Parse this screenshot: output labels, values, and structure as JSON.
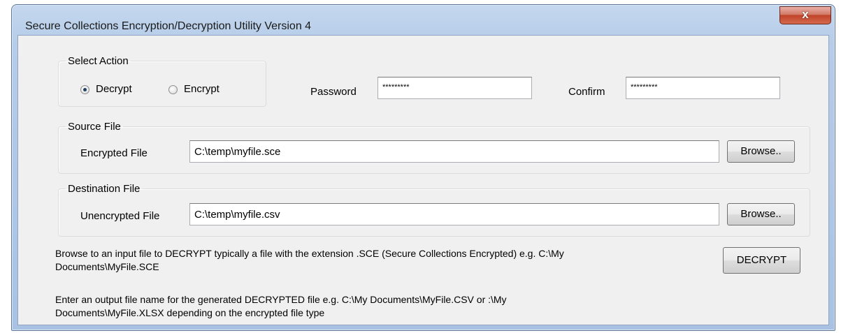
{
  "window": {
    "title": "Secure Collections Encryption/Decryption Utility Version 4",
    "close_symbol": "x"
  },
  "action": {
    "legend": "Select Action",
    "decrypt_label": "Decrypt",
    "encrypt_label": "Encrypt",
    "selected": "Decrypt"
  },
  "password": {
    "label": "Password",
    "value": "*********"
  },
  "confirm": {
    "label": "Confirm",
    "value": "*********"
  },
  "source": {
    "legend": "Source File",
    "label": "Encrypted File",
    "value": "C:\\temp\\myfile.sce",
    "browse_label": "Browse.."
  },
  "destination": {
    "legend": "Destination File",
    "label": "Unencrypted File",
    "value": "C:\\temp\\myfile.csv",
    "browse_label": "Browse.."
  },
  "help": {
    "input_line1": "Browse to an input file to DECRYPT typically a file with the extension .SCE (Secure Collections Encrypted) e.g. C:\\My",
    "input_line2": "Documents\\MyFile.SCE",
    "output_line1": "Enter an output file name for the generated DECRYPTED file e.g. C:\\My Documents\\MyFile.CSV or :\\My",
    "output_line2": "Documents\\MyFile.XLSX depending on the encrypted file type"
  },
  "decrypt_button_label": "DECRYPT",
  "colors": {
    "frame": "#b6cce8",
    "client_bg": "#f0f0f0",
    "close_button": "#c0432a"
  }
}
